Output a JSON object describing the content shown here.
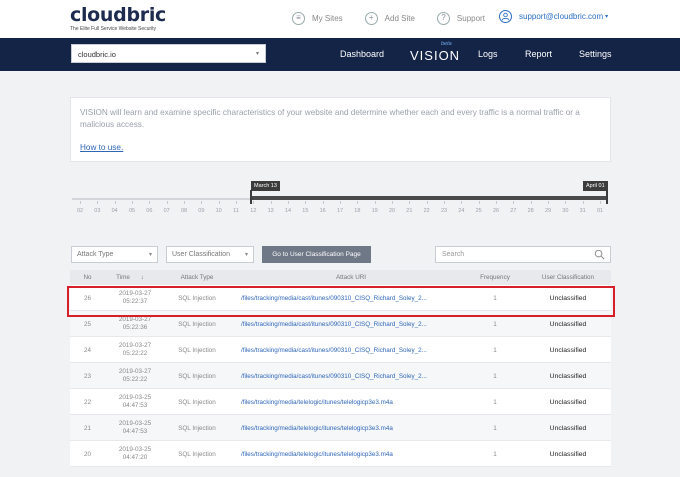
{
  "brand": {
    "name": "cloudbric",
    "tagline": "The Elite Full Service Website Security"
  },
  "top_links": [
    {
      "label": "My Sites",
      "icon": "list-icon"
    },
    {
      "label": "Add Site",
      "icon": "plus-icon"
    },
    {
      "label": "Support",
      "icon": "question-icon"
    }
  ],
  "user": {
    "email": "support@cloudbric.com",
    "icon": "user-icon"
  },
  "site_selector": {
    "value": "cloudbric.io"
  },
  "nav": {
    "dashboard": "Dashboard",
    "vision": "VISION",
    "beta": "beta",
    "logs": "Logs",
    "report": "Report",
    "settings": "Settings"
  },
  "info": {
    "text": "VISION will learn and examine specific characteristics of your website and determine whether each and every traffic is a normal traffic or a malicious access.",
    "link": "How to use."
  },
  "timeline": {
    "start_label": "March 13",
    "end_label": "April 01",
    "ticks": [
      "02",
      "03",
      "04",
      "05",
      "06",
      "07",
      "08",
      "09",
      "10",
      "11",
      "12",
      "13",
      "14",
      "15",
      "16",
      "17",
      "18",
      "19",
      "20",
      "21",
      "22",
      "23",
      "24",
      "25",
      "26",
      "27",
      "28",
      "29",
      "30",
      "31",
      "01"
    ]
  },
  "filters": {
    "attack_type": "Attack Type",
    "user_classification": "User Classification",
    "go_button": "Go to User Classification Page",
    "search_placeholder": "Search"
  },
  "table": {
    "headers": {
      "no": "No",
      "time": "Time",
      "sort": "↓",
      "attack_type": "Attack Type",
      "attack_uri": "Attack URI",
      "frequency": "Frequency",
      "classification": "User Classification"
    },
    "rows": [
      {
        "no": "26",
        "date": "2019-03-27",
        "clock": "05:22:37",
        "attack_type": "SQL Injection",
        "uri": "/files/tracking/media/cast/itunes/090310_CISQ_Richard_Soley_2...",
        "frequency": "1",
        "classification": "Unclassified"
      },
      {
        "no": "25",
        "date": "2019-03-27",
        "clock": "05:22:36",
        "attack_type": "SQL Injection",
        "uri": "/files/tracking/media/cast/itunes/090310_CISQ_Richard_Soley_2...",
        "frequency": "1",
        "classification": "Unclassified"
      },
      {
        "no": "24",
        "date": "2019-03-27",
        "clock": "05:22:22",
        "attack_type": "SQL Injection",
        "uri": "/files/tracking/media/cast/itunes/090310_CISQ_Richard_Soley_2...",
        "frequency": "1",
        "classification": "Unclassified"
      },
      {
        "no": "23",
        "date": "2019-03-27",
        "clock": "05:22:22",
        "attack_type": "SQL Injection",
        "uri": "/files/tracking/media/cast/itunes/090310_CISQ_Richard_Soley_2...",
        "frequency": "1",
        "classification": "Unclassified"
      },
      {
        "no": "22",
        "date": "2019-03-25",
        "clock": "04:47:53",
        "attack_type": "SQL Injection",
        "uri": "/files/tracking/media/telelogic/itunes/telelogicp3e3.m4a",
        "frequency": "1",
        "classification": "Unclassified"
      },
      {
        "no": "21",
        "date": "2019-03-25",
        "clock": "04:47:53",
        "attack_type": "SQL Injection",
        "uri": "/files/tracking/media/telelogic/itunes/telelogicp3e3.m4a",
        "frequency": "1",
        "classification": "Unclassified"
      },
      {
        "no": "20",
        "date": "2019-03-25",
        "clock": "04:47:20",
        "attack_type": "SQL Injection",
        "uri": "/files/tracking/media/telelogic/itunes/telelogicp3e3.m4a",
        "frequency": "1",
        "classification": "Unclassified"
      }
    ]
  },
  "colors": {
    "navy": "#142447",
    "link": "#2f66b8",
    "highlight": "#d71f2a"
  }
}
